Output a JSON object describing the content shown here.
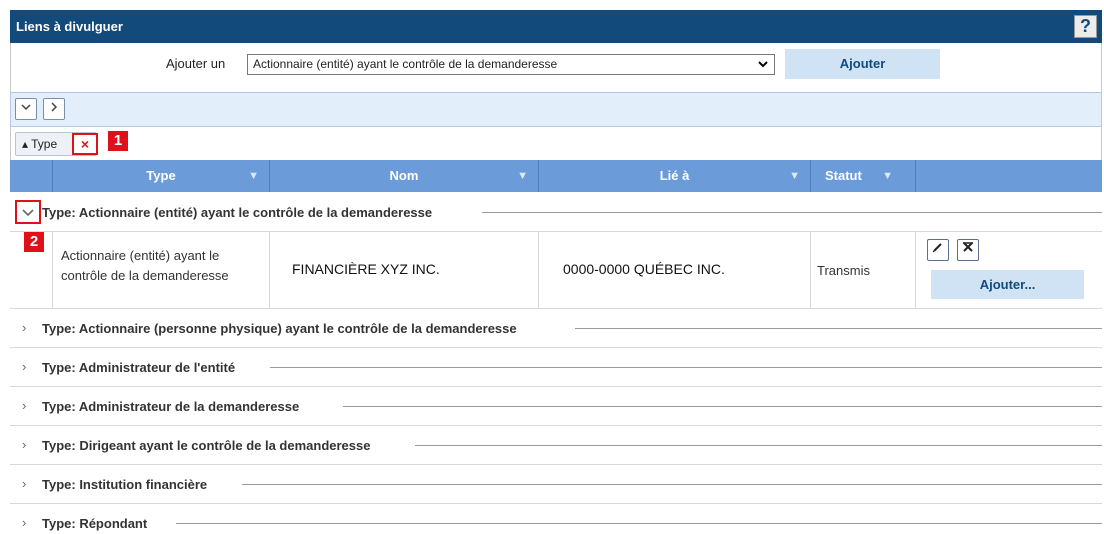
{
  "window": {
    "title": "Liens à divulguer",
    "help_label": "?"
  },
  "add_bar": {
    "label": "Ajouter un",
    "select_value": "Actionnaire (entité) ayant le contrôle de la demanderesse",
    "button_label": "Ajouter"
  },
  "toolbar": {
    "expand_all": "⌄",
    "collapse_all": "›"
  },
  "grouping": {
    "tag_label": "▴ Type",
    "remove_label": "×"
  },
  "badges": [
    "1",
    "2"
  ],
  "columns": [
    {
      "label": "Type"
    },
    {
      "label": "Nom"
    },
    {
      "label": "Lié à"
    },
    {
      "label": "Statut"
    }
  ],
  "expanded_group": {
    "label": "Type: Actionnaire (entité) ayant le contrôle de la demanderesse",
    "row": {
      "type": "Actionnaire (entité) ayant le contrôle de la demanderesse",
      "nom": "FINANCIÈRE XYZ INC.",
      "lie_a": "0000-0000 QUÉBEC INC.",
      "statut": "Transmis",
      "add_label": "Ajouter..."
    }
  },
  "collapsed_groups": [
    "Type: Actionnaire (personne physique) ayant le contrôle de la demanderesse",
    "Type: Administrateur de l'entité",
    "Type: Administrateur de la demanderesse",
    "Type: Dirigeant ayant le contrôle de la demanderesse",
    "Type: Institution financière",
    "Type: Répondant"
  ],
  "colors": {
    "titlebar": "#124a7c",
    "header": "#6b9cd9",
    "toolbar": "#e3eefb",
    "button": "#d0e3f5",
    "highlight": "#e0101a"
  }
}
